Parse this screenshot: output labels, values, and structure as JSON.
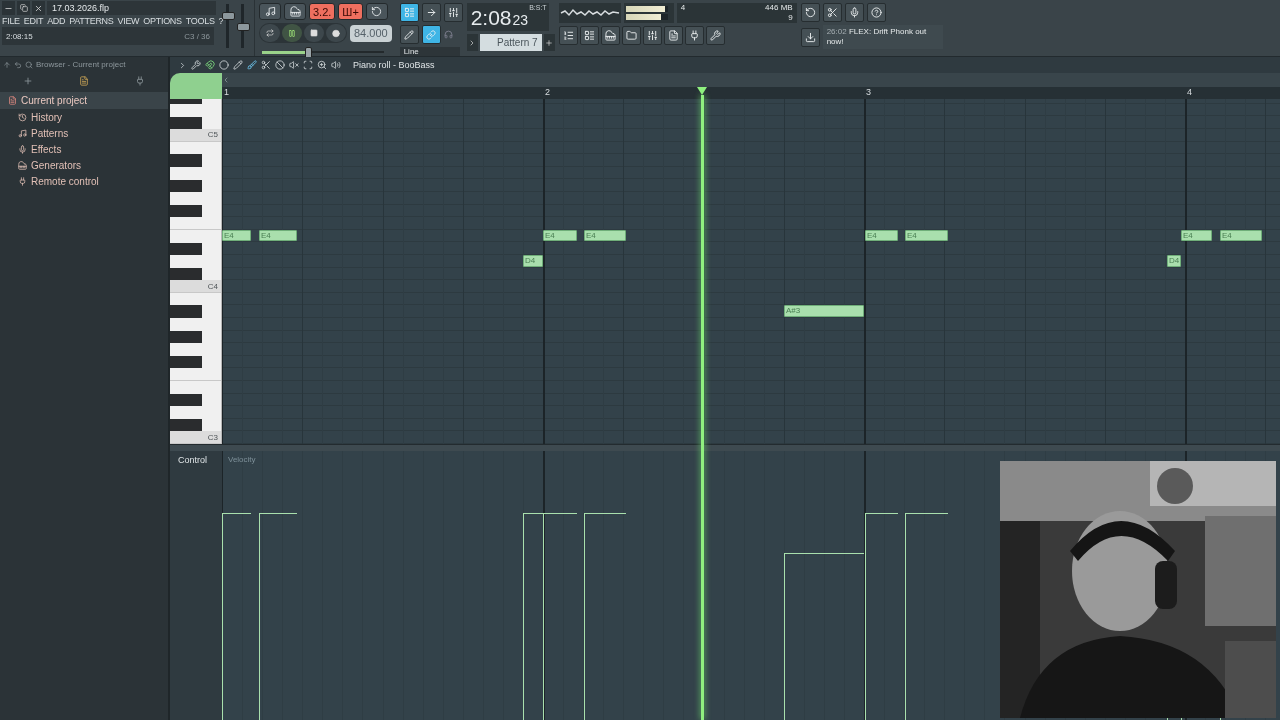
{
  "title_bar": {
    "filename": "17.03.2026.flp"
  },
  "menu": [
    "FILE",
    "EDIT",
    "ADD",
    "PATTERNS",
    "VIEW",
    "OPTIONS",
    "TOOLS",
    "?"
  ],
  "hint_bar": {
    "time": "2:08:15",
    "note": "C3 / 36"
  },
  "master": {
    "volume": {
      "level": 0.8
    },
    "pitch": {
      "level": 0.5
    }
  },
  "toggles": [
    {
      "label": "3.2.",
      "on": true
    },
    {
      "label": "Ш+",
      "on": true
    }
  ],
  "transport": {
    "playing": true,
    "tempo": "84.000",
    "tempo_slider": {
      "level": 0.38
    }
  },
  "snap": {
    "value": "Line"
  },
  "song_time": {
    "main": "2:08",
    "sub": "23",
    "unit": "B:S:T"
  },
  "meters": [
    {
      "level": 0.93
    },
    {
      "level": 0.85
    }
  ],
  "resources": {
    "cpu": "4",
    "memory": "446 MB",
    "polyphony": "9"
  },
  "pattern": {
    "name": "Pattern 7"
  },
  "news": {
    "time": "26:02",
    "text": "FLEX: Drift Phonk out now!"
  },
  "browser": {
    "title": "Browser - Current project",
    "tree": {
      "label": "Current project",
      "children": [
        {
          "label": "History"
        },
        {
          "label": "Patterns"
        },
        {
          "label": "Effects"
        },
        {
          "label": "Generators"
        },
        {
          "label": "Remote control"
        }
      ]
    }
  },
  "piano_roll": {
    "title": "Piano roll - BooBass",
    "bars": [
      "1",
      "2",
      "3",
      "4"
    ],
    "octave_labels": [
      "C5",
      "C4",
      "C3"
    ],
    "notes": [
      {
        "label": "E4"
      },
      {
        "label": "E4"
      },
      {
        "label": "D4"
      },
      {
        "label": "E4"
      },
      {
        "label": "E4"
      },
      {
        "label": "A#3"
      },
      {
        "label": "E4"
      },
      {
        "label": "E4"
      },
      {
        "label": "D4"
      },
      {
        "label": "E4"
      },
      {
        "label": "E4"
      }
    ],
    "control": {
      "label": "Control",
      "parameter": "Velocity"
    }
  }
}
